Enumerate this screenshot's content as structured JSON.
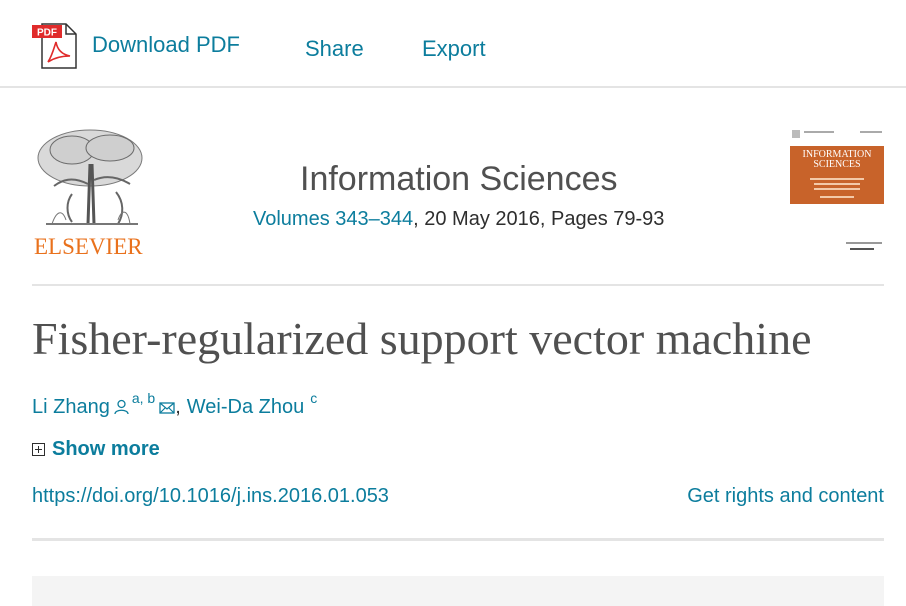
{
  "toolbar": {
    "pdf_badge": "PDF",
    "download_pdf_label": "Download PDF",
    "share_label": "Share",
    "export_label": "Export"
  },
  "journal": {
    "publisher_logo_text": "ELSEVIER",
    "title": "Information Sciences",
    "volumes_link": "Volumes 343–344",
    "issue_rest": ", 20 May 2016, Pages 79-93",
    "cover_title": "INFORMATION SCIENCES"
  },
  "article": {
    "title": "Fisher-regularized support vector machine",
    "authors": [
      {
        "name": "Li Zhang",
        "affiliations": "a, b"
      },
      {
        "name": "Wei-Da Zhou",
        "affiliations": "c"
      }
    ],
    "author_separator": ",",
    "show_more_label": "Show more",
    "doi": "https://doi.org/10.1016/j.ins.2016.01.053",
    "rights_label": "Get rights and content"
  },
  "colors": {
    "link": "#0c7d9d",
    "orange": "#e9711c",
    "cover": "#c8632a"
  }
}
